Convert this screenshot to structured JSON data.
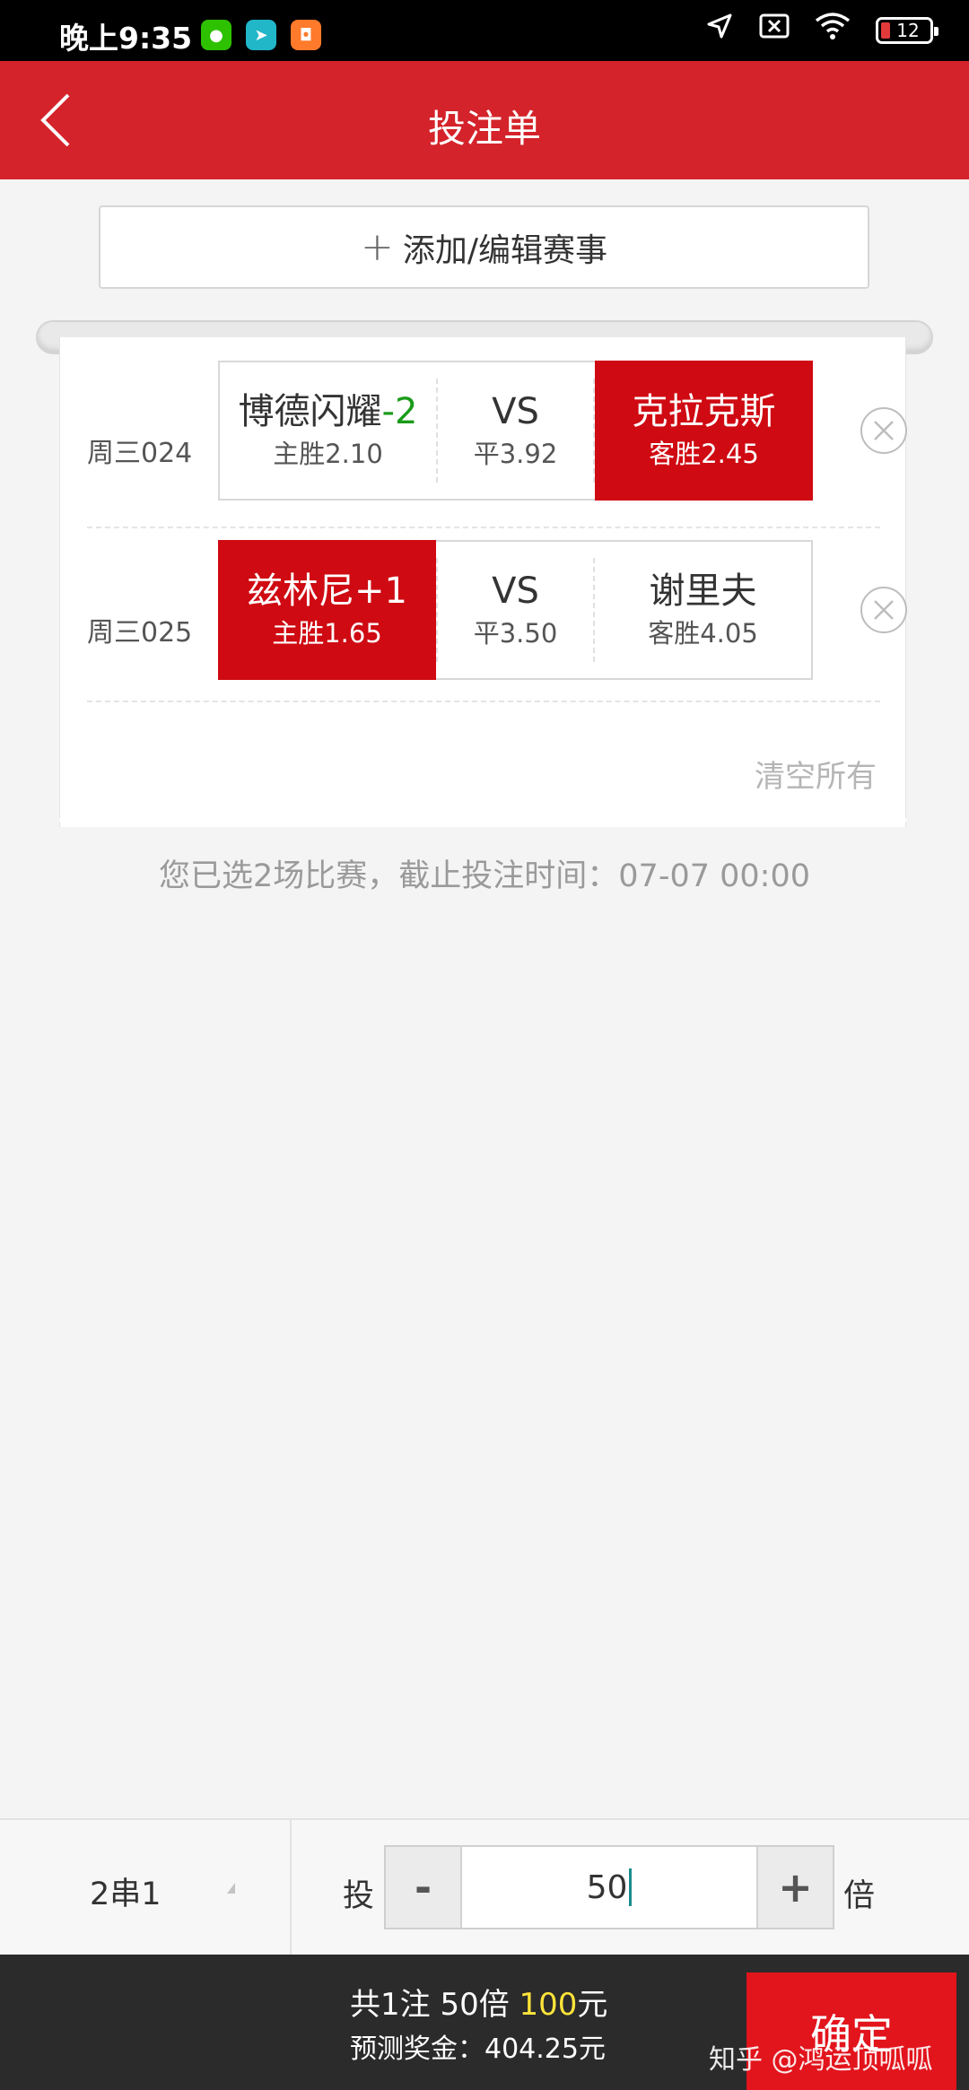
{
  "status_bar": {
    "time": "晚上9:35",
    "battery": "12",
    "colors": {
      "wechat": "#2dc100",
      "plane": "#21b6c8",
      "shop": "#ff7a2b"
    }
  },
  "header": {
    "title": "投注单",
    "color": "#d4232a"
  },
  "add_button": {
    "plus": "+",
    "label": "添加/编辑赛事"
  },
  "matches": [
    {
      "id": "周三024",
      "home": {
        "name": "博德闪耀",
        "handicap": "-2",
        "odds": "主胜2.10",
        "selected": false
      },
      "draw": {
        "name": "VS",
        "odds": "平3.92",
        "selected": false
      },
      "away": {
        "name": "克拉克斯",
        "odds": "客胜2.45",
        "selected": true
      }
    },
    {
      "id": "周三025",
      "home": {
        "name": "兹林尼",
        "handicap": "+1",
        "odds": "主胜1.65",
        "selected": true
      },
      "draw": {
        "name": "VS",
        "odds": "平3.50",
        "selected": false
      },
      "away": {
        "name": "谢里夫",
        "odds": "客胜4.05",
        "selected": false
      }
    }
  ],
  "clear_all": "清空所有",
  "info_line": "您已选2场比赛，截止投注时间：07-07 00:00",
  "controls": {
    "pass_type": "2串1",
    "bet_label": "投",
    "minus": "-",
    "multiplier": "50",
    "plus": "+",
    "times_label": "倍"
  },
  "footer": {
    "summary_prefix": "共1注 50倍 ",
    "amount": "100",
    "unit": "元",
    "prize": "预测奖金：404.25元",
    "confirm": "确定",
    "watermark": "知乎 @鸿运顶呱呱",
    "accent": "#ffe43a",
    "confirm_color": "#e2141c"
  }
}
